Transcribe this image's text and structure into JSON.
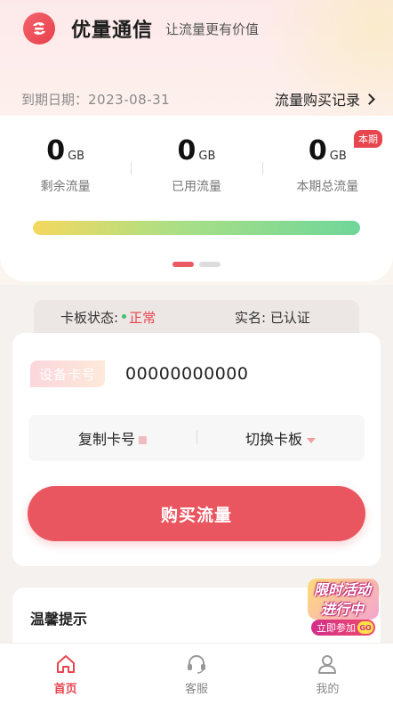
{
  "header": {
    "app_name": "优量通信",
    "slogan": "让流量更有价值",
    "expiry_label": "到期日期：",
    "expiry_date": "2023-08-31",
    "history_link": "流量购买记录"
  },
  "usage": {
    "stats": [
      {
        "value": "0",
        "unit": "GB",
        "label": "剩余流量"
      },
      {
        "value": "0",
        "unit": "GB",
        "label": "已用流量"
      },
      {
        "value": "0",
        "unit": "GB",
        "label": "本期总流量",
        "badge": "本期"
      }
    ],
    "progress_fraction": 1.0,
    "carousel_pages": 2,
    "carousel_active": 0
  },
  "status": {
    "board_label": "卡板状态:",
    "board_value": "正常",
    "realname_label": "实名:",
    "realname_value": "已认证"
  },
  "card": {
    "tag": "设备卡号",
    "number": "00000000000",
    "copy_label": "复制卡号",
    "switch_label": "切换卡板",
    "buy_label": "购买流量"
  },
  "tips": {
    "title": "温馨提示"
  },
  "promo": {
    "line1": "限时活动",
    "line2": "进行中",
    "button": "立即参加",
    "go": "GO"
  },
  "tabbar": [
    {
      "label": "首页",
      "icon": "home-icon",
      "active": true
    },
    {
      "label": "客服",
      "icon": "headset-icon",
      "active": false
    },
    {
      "label": "我的",
      "icon": "user-icon",
      "active": false
    }
  ],
  "colors": {
    "accent": "#e8464f",
    "status_ok_dot": "#3cc46a"
  }
}
